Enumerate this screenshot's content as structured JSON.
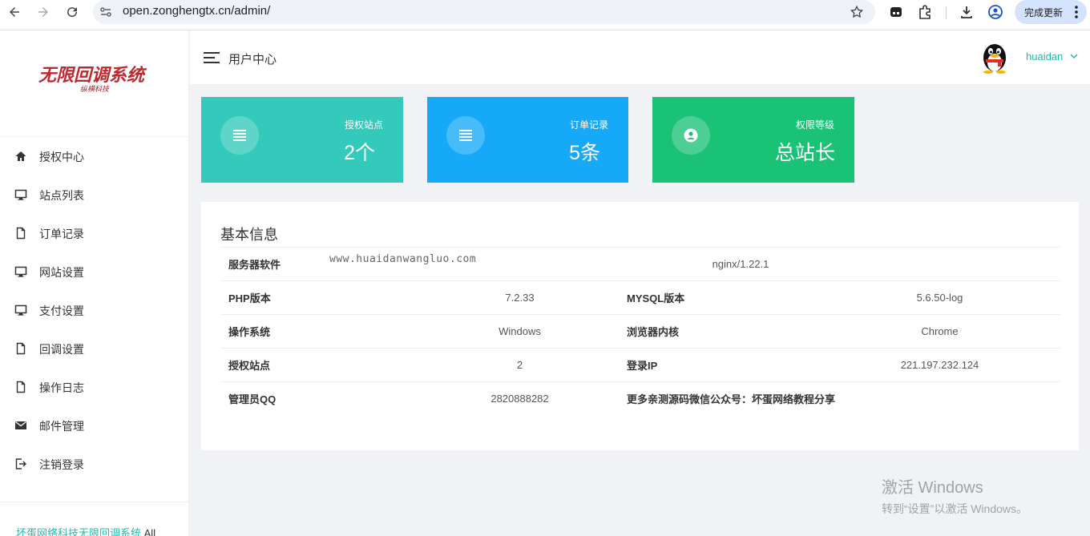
{
  "browser": {
    "url": "open.zonghengtx.cn/admin/",
    "update_button": "完成更新"
  },
  "sidebar": {
    "logo_title": "无限回调系统",
    "logo_subtitle": "纵横科技",
    "items": [
      {
        "label": "授权中心",
        "icon": "home-icon"
      },
      {
        "label": "站点列表",
        "icon": "monitor-icon"
      },
      {
        "label": "订单记录",
        "icon": "file-icon"
      },
      {
        "label": "网站设置",
        "icon": "monitor-icon"
      },
      {
        "label": "支付设置",
        "icon": "monitor-icon"
      },
      {
        "label": "回调设置",
        "icon": "file-icon"
      },
      {
        "label": "操作日志",
        "icon": "file-icon"
      },
      {
        "label": "邮件管理",
        "icon": "mail-icon"
      },
      {
        "label": "注销登录",
        "icon": "logout-icon"
      }
    ],
    "footer_text": "坏蛋网络科技无限回调系统",
    "footer_suffix": "All"
  },
  "header": {
    "title": "用户中心",
    "username": "huaidan"
  },
  "cards": [
    {
      "label": "授权站点",
      "value": "2个",
      "color": "#33cabb",
      "icon": "list-icon"
    },
    {
      "label": "订单记录",
      "value": "5条",
      "color": "#15a9f7",
      "icon": "list-icon"
    },
    {
      "label": "权限等级",
      "value": "总站长",
      "color": "#1ac276",
      "icon": "user-circle-icon"
    }
  ],
  "info": {
    "title": "基本信息",
    "overlay_text": "www.huaidanwangluo.com",
    "rows": [
      {
        "k1": "服务器软件",
        "v1": "nginx/1.22.1"
      },
      {
        "k1": "PHP版本",
        "v1": "7.2.33",
        "k2": "MYSQL版本",
        "v2": "5.6.50-log"
      },
      {
        "k1": "操作系统",
        "v1": "Windows",
        "k2": "浏览器内核",
        "v2": "Chrome"
      },
      {
        "k1": "授权站点",
        "v1": "2",
        "k2": "登录IP",
        "v2": "221.197.232.124"
      },
      {
        "k1": "管理员QQ",
        "v1": "2820888282",
        "k2": "更多亲测源码微信公众号：坏蛋网络教程分享",
        "v2": ""
      }
    ]
  },
  "windows_activation": {
    "line1": "激活 Windows",
    "line2": "转到“设置”以激活 Windows。"
  }
}
